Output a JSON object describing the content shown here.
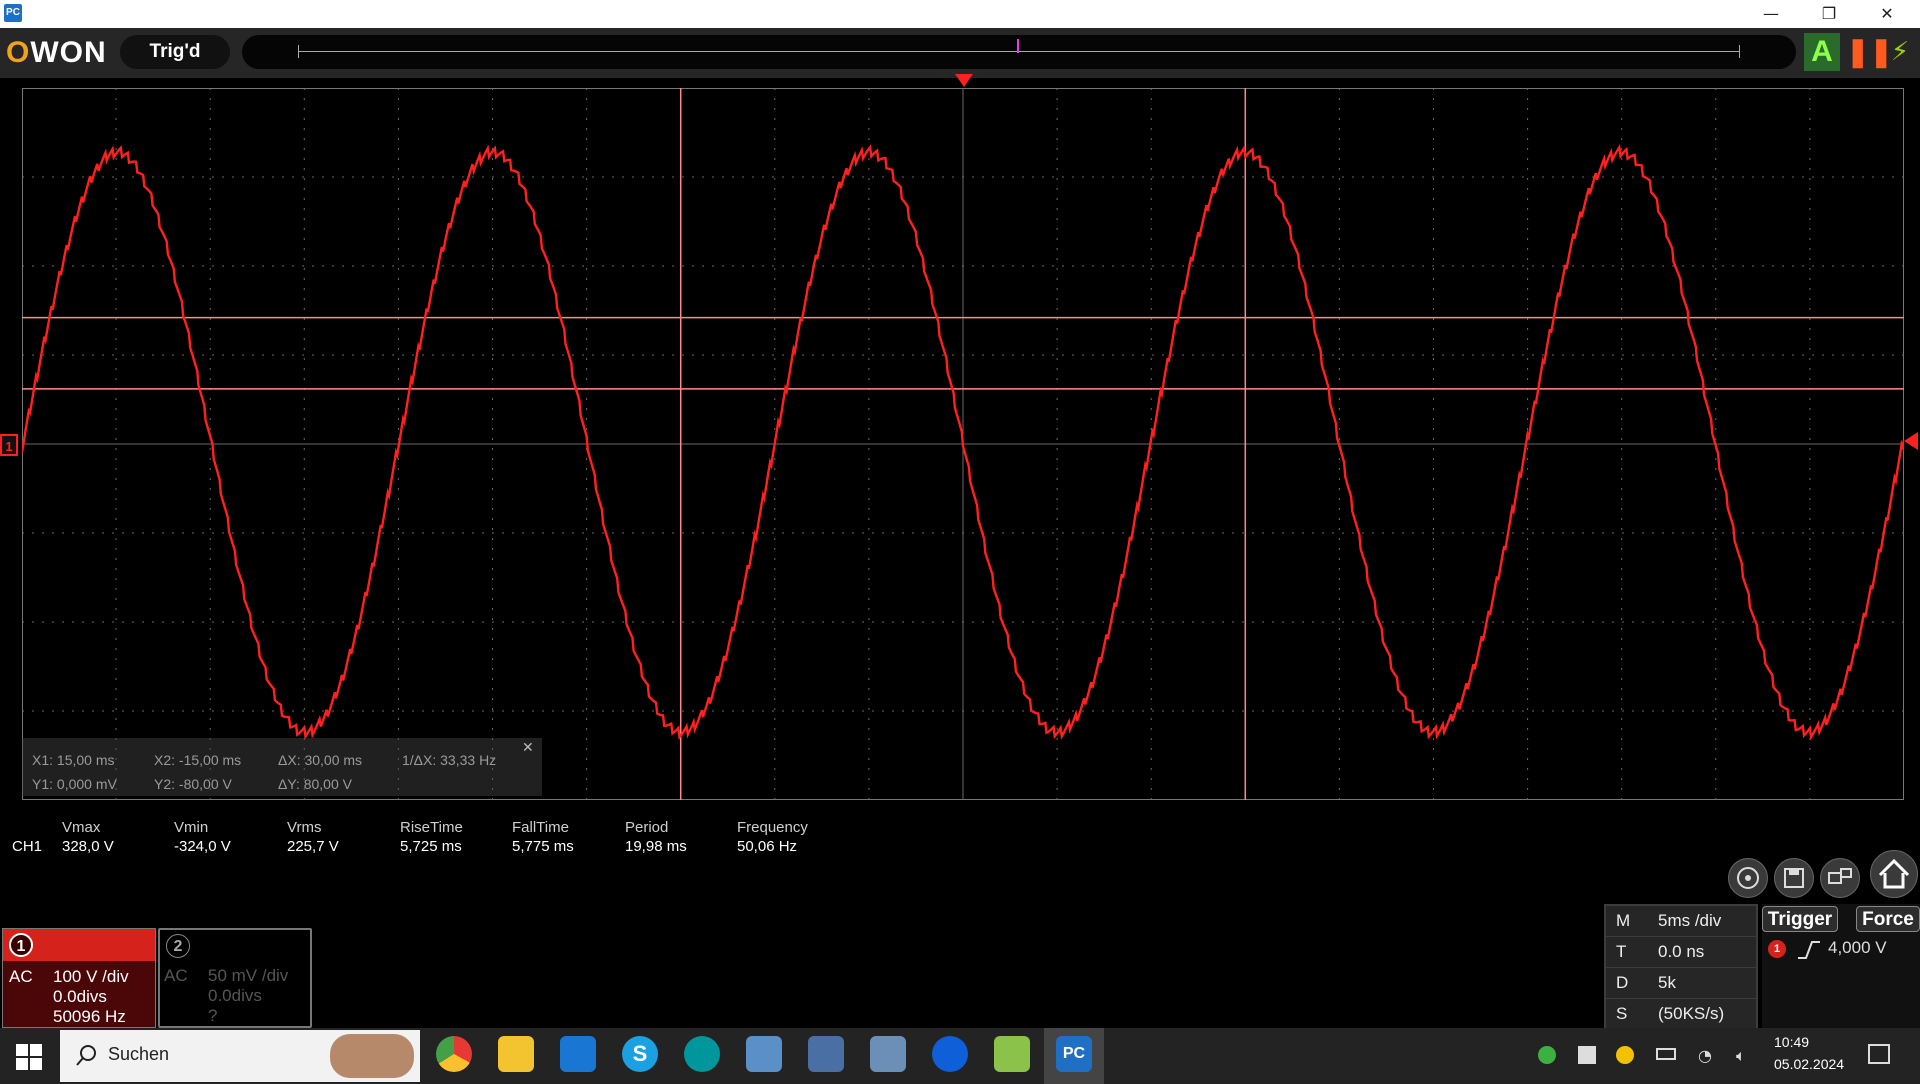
{
  "window": {
    "app_icon": "PC",
    "minimize": "—",
    "restore": "❐",
    "close": "✕"
  },
  "toolbar": {
    "logo_first": "O",
    "logo_rest": "WON",
    "status": "Trig'd",
    "auto_label": "A"
  },
  "scope": {
    "colors": {
      "trace": "#ff2020",
      "grid": "#6a6a6a",
      "cursor": "#ff8a8a"
    },
    "channel_marker": "1",
    "divisions_x": 20,
    "divisions_y": 8
  },
  "chart_data": {
    "type": "line",
    "title": "",
    "xlabel": "",
    "ylabel": "",
    "x_unit": "ms",
    "y_unit": "V",
    "xlim": [
      -50,
      50
    ],
    "ylim": [
      -400,
      400
    ],
    "series": [
      {
        "frequency_hz": 50.06,
        "vmax": 328.0,
        "vmin": -324.0
      }
    ],
    "cursors": {
      "x1_ms": 15.0,
      "x2_ms": -15.0,
      "y1_v": 0.0,
      "y2_v": -80.0
    }
  },
  "cursor_info": {
    "x1": "X1: 15,00 ms",
    "x2": "X2: -15,00 ms",
    "dx": "ΔX: 30,00 ms",
    "inv_dx": "1/ΔX: 33,33 Hz",
    "y1": "Y1: 0,000 mV",
    "y2": "Y2: -80,00 V",
    "dy": "ΔY: 80,00 V",
    "close": "✕"
  },
  "measurements": {
    "channel": "CH1",
    "headers": [
      "Vmax",
      "Vmin",
      "Vrms",
      "RiseTime",
      "FallTime",
      "Period",
      "Frequency"
    ],
    "values": [
      "328,0 V",
      "-324,0 V",
      "225,7 V",
      "5,725 ms",
      "5,775 ms",
      "19,98 ms",
      "50,06 Hz"
    ]
  },
  "ch1": {
    "number": "1",
    "coupling": "AC",
    "scale": "100 V /div",
    "offset": "0.0divs",
    "freq": "50096 Hz"
  },
  "ch2": {
    "number": "2",
    "coupling": "AC",
    "scale": "50 mV /div",
    "offset": "0.0divs",
    "freq": "?"
  },
  "timebase": {
    "rows": [
      {
        "k": "M",
        "v": "5ms /div"
      },
      {
        "k": "T",
        "v": "0.0 ns"
      },
      {
        "k": "D",
        "v": "5k"
      },
      {
        "k": "S",
        "v": "(50KS/s)"
      }
    ]
  },
  "trigger": {
    "trigger_label": "Trigger",
    "force_label": "Force",
    "channel": "1",
    "level": "4,000 V"
  },
  "taskbar": {
    "search_placeholder": "Suchen",
    "time": "10:49",
    "date": "05.02.2024"
  }
}
